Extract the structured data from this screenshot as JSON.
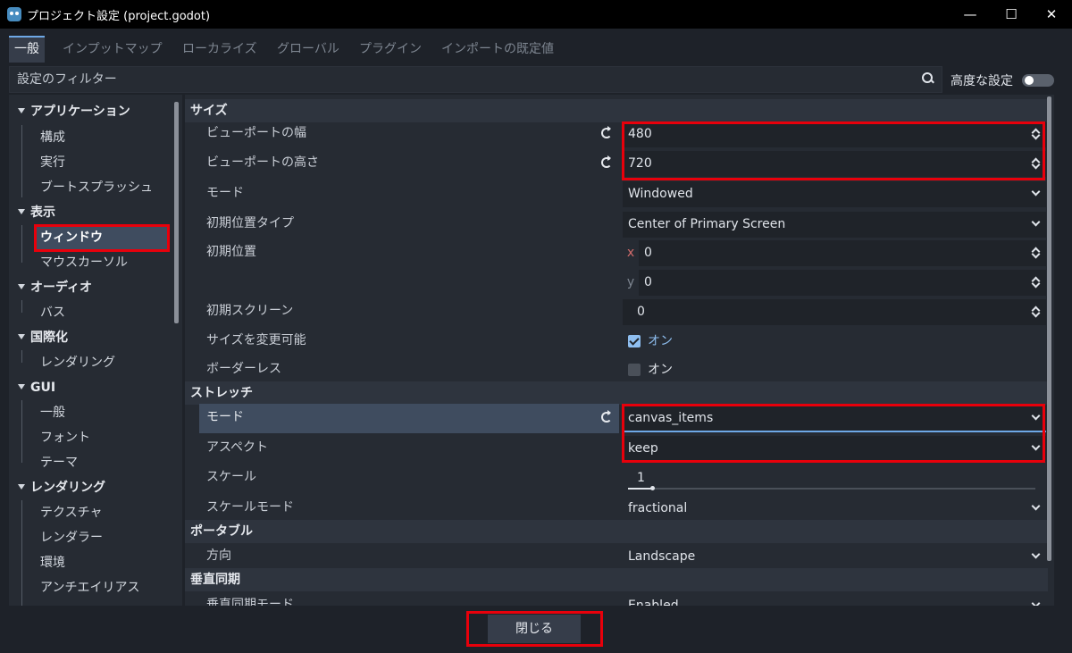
{
  "window": {
    "title": "プロジェクト設定 (project.godot)",
    "minimize": "—",
    "maximize": "☐",
    "close": "✕"
  },
  "tabs": [
    {
      "label": "一般",
      "active": true
    },
    {
      "label": "インプットマップ"
    },
    {
      "label": "ローカライズ"
    },
    {
      "label": "グローバル"
    },
    {
      "label": "プラグイン"
    },
    {
      "label": "インポートの既定値"
    }
  ],
  "filter": {
    "placeholder": "設定のフィルター",
    "advanced_label": "高度な設定",
    "advanced_on": false
  },
  "tree": {
    "cat_application": "アプリケーション",
    "item_config": "構成",
    "item_run": "実行",
    "item_boot": "ブートスプラッシュ",
    "cat_display": "表示",
    "item_window": "ウィンドウ",
    "item_mouse": "マウスカーソル",
    "cat_audio": "オーディオ",
    "item_bus": "バス",
    "cat_i18n": "国際化",
    "item_i18n_render": "レンダリング",
    "cat_gui": "GUI",
    "item_gui_common": "一般",
    "item_gui_font": "フォント",
    "item_gui_theme": "テーマ",
    "cat_rendering": "レンダリング",
    "item_texture": "テクスチャ",
    "item_renderer": "レンダラー",
    "item_env": "環境",
    "item_aa": "アンチエイリアス"
  },
  "sections": {
    "size": "サイズ",
    "stretch": "ストレッチ",
    "portable": "ポータブル",
    "vsync": "垂直同期"
  },
  "props": {
    "vp_width": {
      "label": "ビューポートの幅",
      "value": "480"
    },
    "vp_height": {
      "label": "ビューポートの高さ",
      "value": "720"
    },
    "mode": {
      "label": "モード",
      "value": "Windowed"
    },
    "init_pos_type": {
      "label": "初期位置タイプ",
      "value": "Center of Primary Screen"
    },
    "init_pos": {
      "label": "初期位置",
      "x_label": "x",
      "x": "0",
      "y_label": "y",
      "y": "0"
    },
    "init_screen": {
      "label": "初期スクリーン",
      "value": "0"
    },
    "resizable": {
      "label": "サイズを変更可能",
      "value": "オン",
      "checked": true
    },
    "borderless": {
      "label": "ボーダーレス",
      "value": "オン",
      "checked": false
    },
    "stretch_mode": {
      "label": "モード",
      "value": "canvas_items"
    },
    "aspect": {
      "label": "アスペクト",
      "value": "keep"
    },
    "scale": {
      "label": "スケール",
      "value": "1",
      "fraction": 0.06
    },
    "scale_mode": {
      "label": "スケールモード",
      "value": "fractional"
    },
    "orientation": {
      "label": "方向",
      "value": "Landscape"
    },
    "vsync_mode": {
      "label": "垂直同期モード",
      "value": "Enabled"
    }
  },
  "footer": {
    "close_label": "閉じる"
  },
  "colors": {
    "accent": "#6ea8e6",
    "annotation": "#e8000b",
    "selection": "#3f4c5f"
  }
}
